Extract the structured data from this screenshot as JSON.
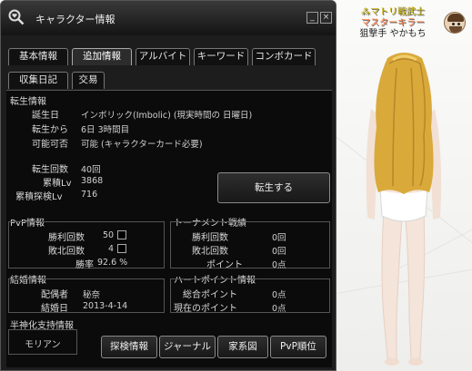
{
  "window": {
    "title": "キャラクター情報",
    "minimize_glyph": "_",
    "close_glyph": "×"
  },
  "tabs_row1": [
    "基本情報",
    "追加情報",
    "アルバイト",
    "キーワード",
    "コンボカード"
  ],
  "tabs_row2": [
    "収集日記",
    "交易"
  ],
  "active_tab": "追加情報",
  "rebirth": {
    "section": "転生情報",
    "birthday_label": "誕生日",
    "birthday_value": "インボリック(Imbolic) (現実時間の 日曜日)",
    "since_label": "転生から",
    "since_value": "6日 3時間目",
    "possible_label": "可能可否",
    "possible_value": "可能 (キャラクターカード必要)",
    "count_label": "転生回数",
    "count_value": "40回",
    "cum_label": "累積Lv",
    "cum_value": "3868",
    "cum_explore_label": "累積探検Lv",
    "cum_explore_value": "716",
    "rebirth_button": "転生する"
  },
  "pvp": {
    "section": "PvP情報",
    "wins_label": "勝利回数",
    "wins_value": "50",
    "losses_label": "敗北回数",
    "losses_value": "4",
    "rate_label": "勝率",
    "rate_value": "92.6 %"
  },
  "tournament": {
    "section": "トーナメント戦績",
    "wins_label": "勝利回数",
    "wins_value": "0回",
    "losses_label": "敗北回数",
    "losses_value": "0回",
    "points_label": "ポイント",
    "points_value": "0点"
  },
  "marriage": {
    "section": "結婚情報",
    "spouse_label": "配偶者",
    "spouse_value": "秘奈",
    "date_label": "結婚日",
    "date_value": "2013-4-14"
  },
  "heart": {
    "section": "ハートポイント情報",
    "total_label": "総合ポイント",
    "total_value": "0点",
    "current_label": "現在のポイント",
    "current_value": "0点"
  },
  "support": {
    "section": "半神化支持情報",
    "value": "モリアン"
  },
  "bottom_buttons": [
    "探検情報",
    "ジャーナル",
    "家系図",
    "PvP順位"
  ],
  "player": {
    "title": "⁂マトリ戦武士",
    "subtitle": "マスターキラー",
    "name": "狙撃手 やかもち"
  },
  "icons": {
    "title": "magnifier-heart-icon",
    "avatar": "player-avatar-icon"
  }
}
